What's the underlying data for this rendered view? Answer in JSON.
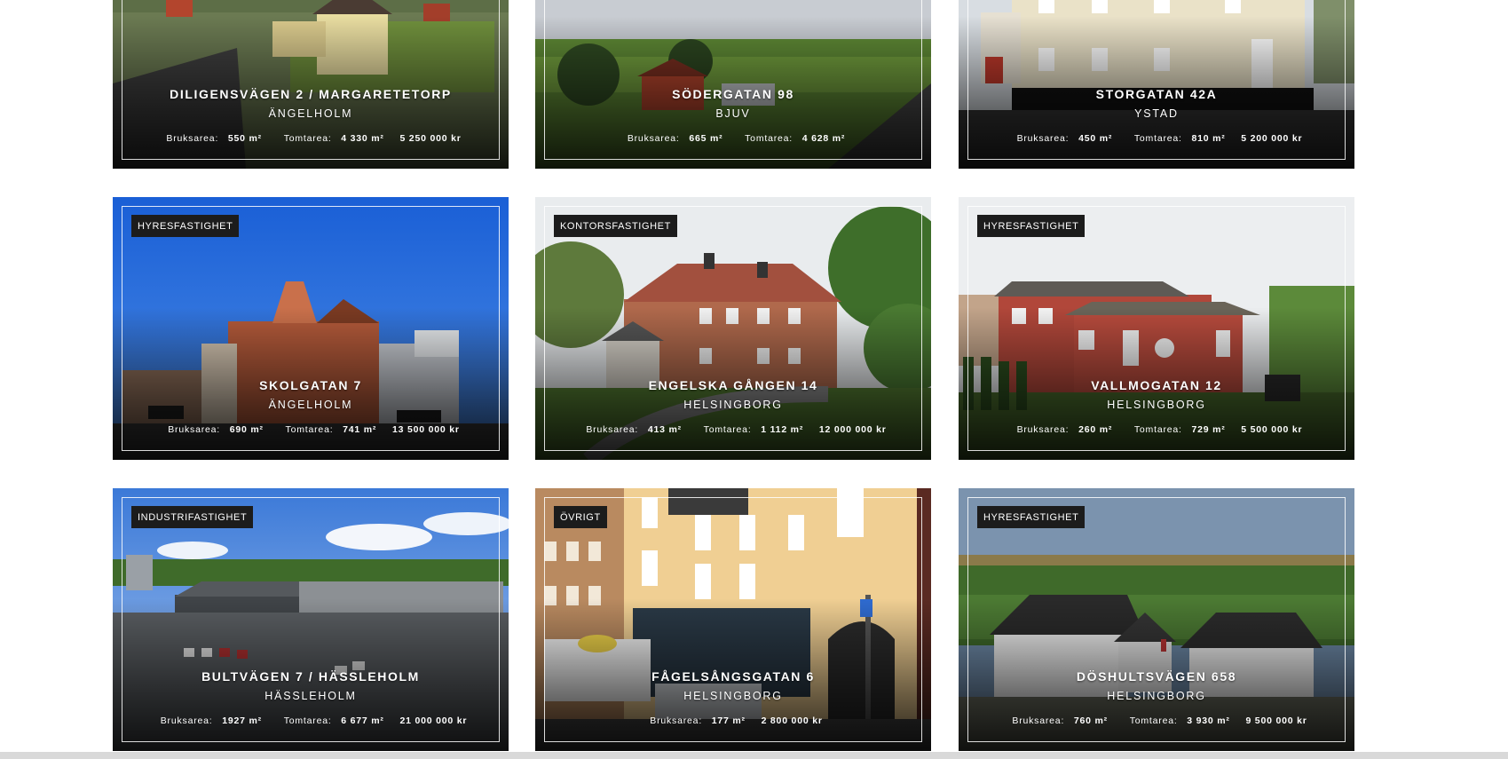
{
  "properties": [
    {
      "title": "Diligensvägen 2 / Margaretetorp",
      "city": "Ängelholm",
      "area_label": "Bruksarea:",
      "area": "550 m²",
      "plot_label": "Tomtarea:",
      "plot": "4 330 m²",
      "price": "5 250 000 kr",
      "badge": ""
    },
    {
      "title": "Södergatan 98",
      "city": "Bjuv",
      "area_label": "Bruksarea:",
      "area": "665 m²",
      "plot_label": "Tomtarea:",
      "plot": "4 628 m²",
      "price": "",
      "badge": ""
    },
    {
      "title": "Storgatan 42A",
      "city": "Ystad",
      "area_label": "Bruksarea:",
      "area": "450 m²",
      "plot_label": "Tomtarea:",
      "plot": "810 m²",
      "price": "5 200 000 kr",
      "badge": ""
    },
    {
      "title": "Skolgatan 7",
      "city": "Ängelholm",
      "area_label": "Bruksarea:",
      "area": "690 m²",
      "plot_label": "Tomtarea:",
      "plot": "741 m²",
      "price": "13 500 000 kr",
      "badge": "Hyresfastighet"
    },
    {
      "title": "Engelska gången 14",
      "city": "Helsingborg",
      "area_label": "Bruksarea:",
      "area": "413 m²",
      "plot_label": "Tomtarea:",
      "plot": "1 112 m²",
      "price": "12 000 000 kr",
      "badge": "Kontorsfastighet"
    },
    {
      "title": "Vallmogatan 12",
      "city": "Helsingborg",
      "area_label": "Bruksarea:",
      "area": "260 m²",
      "plot_label": "Tomtarea:",
      "plot": "729 m²",
      "price": "5 500 000 kr",
      "badge": "Hyresfastighet"
    },
    {
      "title": "Bultvägen 7 / Hässleholm",
      "city": "Hässleholm",
      "area_label": "Bruksarea:",
      "area": "1927 m²",
      "plot_label": "Tomtarea:",
      "plot": "6 677 m²",
      "price": "21 000 000 kr",
      "badge": "Industrifastighet"
    },
    {
      "title": "Fågelsångsgatan 6",
      "city": "Helsingborg",
      "area_label": "Bruksarea:",
      "area": "177 m²",
      "plot_label": "",
      "plot": "",
      "price": "2 800 000 kr",
      "badge": "Övrigt"
    },
    {
      "title": "Döshultsvägen 658",
      "city": "Helsingborg",
      "area_label": "Bruksarea:",
      "area": "760 m²",
      "plot_label": "Tomtarea:",
      "plot": "3 930 m²",
      "price": "9 500 000 kr",
      "badge": "Hyresfastighet"
    }
  ]
}
